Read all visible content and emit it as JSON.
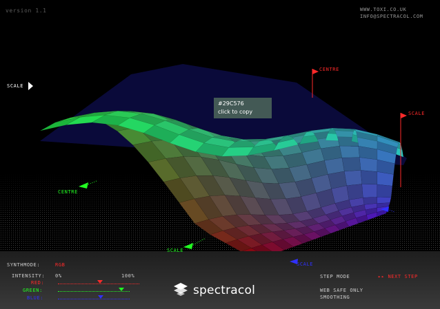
{
  "header": {
    "version": "version 1.1",
    "site": "WWW.TOXI.CO.UK",
    "email": "INFO@SPECTRACOL.COM"
  },
  "tooltip": {
    "hex": "#29C576",
    "action": "click to copy"
  },
  "markers": {
    "scale_left": "SCALE",
    "centre_top": "CENTRE",
    "scale_right": "SCALE",
    "centre_left": "CENTRE",
    "scale_bottom_green": "SCALE",
    "scale_bottom_blue": "SCALE"
  },
  "colors": {
    "red": "#ff2a2a",
    "green": "#22ff22",
    "blue": "#3030ff",
    "label": "#cfcfcf"
  },
  "controls": {
    "synthmode_label": "SYNTHMODE:",
    "synthmode_value": "RGB",
    "intensity_label": "INTENSITY:",
    "intensity_min": "0%",
    "intensity_max": "100%",
    "red_label": "RED:",
    "green_label": "GREEN:",
    "blue_label": "BLUE:",
    "red_level": 0.52,
    "green_level": 0.88,
    "blue_level": 0.6
  },
  "options": {
    "step_mode_label": "STEP MODE",
    "next_step_label": "NEXT STEP",
    "web_safe_label": "WEB SAFE ONLY",
    "smoothing_label": "SMOOTHING"
  },
  "brand": {
    "name": "spectracol",
    "logo_icon": "spectracol-logo-icon"
  }
}
